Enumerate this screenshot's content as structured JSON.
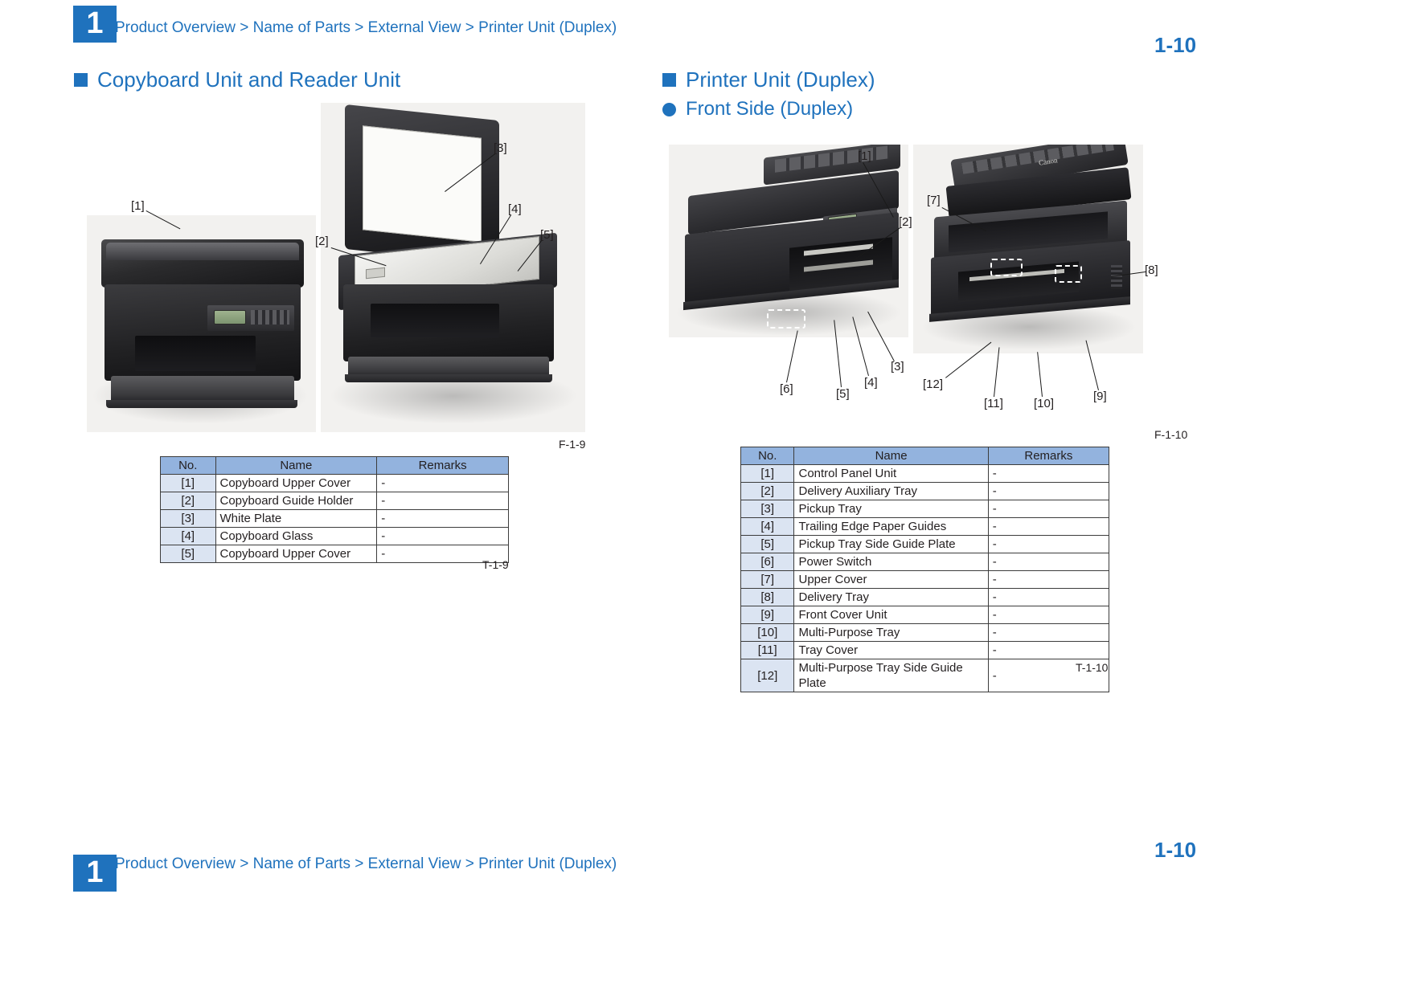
{
  "header": {
    "chapter": "1",
    "breadcrumb": "Product Overview > Name of Parts > External View > Printer Unit (Duplex)",
    "page_number": "1-10"
  },
  "footer": {
    "chapter": "1",
    "breadcrumb": "Product Overview > Name of Parts > External View > Printer Unit (Duplex)",
    "page_number": "1-10"
  },
  "left_section": {
    "heading": "Copyboard Unit and Reader Unit",
    "figure_caption": "F-1-9",
    "table_caption": "T-1-9",
    "callouts": [
      "[1]",
      "[2]",
      "[3]",
      "[4]",
      "[5]"
    ],
    "table": {
      "columns": [
        "No.",
        "Name",
        "Remarks"
      ],
      "rows": [
        {
          "no": "[1]",
          "name": "Copyboard Upper Cover",
          "remarks": "-"
        },
        {
          "no": "[2]",
          "name": "Copyboard Guide Holder",
          "remarks": "-"
        },
        {
          "no": "[3]",
          "name": "White Plate",
          "remarks": "-"
        },
        {
          "no": "[4]",
          "name": "Copyboard Glass",
          "remarks": "-"
        },
        {
          "no": "[5]",
          "name": "Copyboard Upper Cover",
          "remarks": "-"
        }
      ]
    }
  },
  "right_section": {
    "heading": "Printer Unit (Duplex)",
    "sub_heading": "Front Side (Duplex)",
    "figure_caption": "F-1-10",
    "table_caption": "T-1-10",
    "callouts": [
      "[1]",
      "[2]",
      "[3]",
      "[4]",
      "[5]",
      "[6]",
      "[7]",
      "[8]",
      "[9]",
      "[10]",
      "[11]",
      "[12]"
    ],
    "table": {
      "columns": [
        "No.",
        "Name",
        "Remarks"
      ],
      "rows": [
        {
          "no": "[1]",
          "name": "Control Panel Unit",
          "remarks": "-"
        },
        {
          "no": "[2]",
          "name": "Delivery Auxiliary Tray",
          "remarks": "-"
        },
        {
          "no": "[3]",
          "name": "Pickup Tray",
          "remarks": "-"
        },
        {
          "no": "[4]",
          "name": "Trailing Edge Paper Guides",
          "remarks": "-"
        },
        {
          "no": "[5]",
          "name": "Pickup Tray Side Guide Plate",
          "remarks": "-"
        },
        {
          "no": "[6]",
          "name": "Power Switch",
          "remarks": "-"
        },
        {
          "no": "[7]",
          "name": "Upper Cover",
          "remarks": "-"
        },
        {
          "no": "[8]",
          "name": "Delivery Tray",
          "remarks": "-"
        },
        {
          "no": "[9]",
          "name": "Front Cover Unit",
          "remarks": "-"
        },
        {
          "no": "[10]",
          "name": "Multi-Purpose Tray",
          "remarks": "-"
        },
        {
          "no": "[11]",
          "name": "Tray Cover",
          "remarks": "-"
        },
        {
          "no": "[12]",
          "name": "Multi-Purpose Tray Side Guide Plate",
          "remarks": "-"
        }
      ]
    }
  },
  "colors": {
    "accent": "#1f72bd",
    "table_header": "#93b3de",
    "table_no_cell": "#dbe4f2"
  },
  "brand_text": "Canon"
}
